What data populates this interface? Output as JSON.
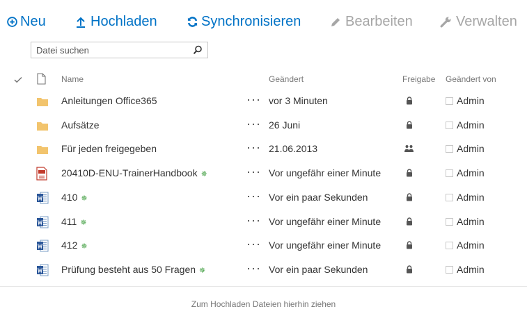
{
  "toolbar": {
    "new_label": "Neu",
    "upload_label": "Hochladen",
    "sync_label": "Synchronisieren",
    "edit_label": "Bearbeiten",
    "manage_label": "Verwalten"
  },
  "search": {
    "placeholder": "Datei suchen"
  },
  "columns": {
    "name": "Name",
    "modified": "Geändert",
    "sharing": "Freigabe",
    "modified_by": "Geändert von"
  },
  "files": [
    {
      "type": "folder",
      "name": "Anleitungen Office365",
      "is_new": false,
      "modified": "vor 3 Minuten",
      "sharing": "lock",
      "modified_by": "Admin"
    },
    {
      "type": "folder",
      "name": "Aufsätze",
      "is_new": false,
      "modified": "26 Juni",
      "sharing": "lock",
      "modified_by": "Admin"
    },
    {
      "type": "folder",
      "name": "Für jeden freigegeben",
      "is_new": false,
      "modified": "21.06.2013",
      "sharing": "people",
      "modified_by": "Admin"
    },
    {
      "type": "pdf",
      "name": "20410D-ENU-TrainerHandbook",
      "is_new": true,
      "modified": "Vor ungefähr einer Minute",
      "sharing": "lock",
      "modified_by": "Admin"
    },
    {
      "type": "word",
      "name": "410",
      "is_new": true,
      "modified": "Vor ein paar Sekunden",
      "sharing": "lock",
      "modified_by": "Admin"
    },
    {
      "type": "word",
      "name": "411",
      "is_new": true,
      "modified": "Vor ungefähr einer Minute",
      "sharing": "lock",
      "modified_by": "Admin"
    },
    {
      "type": "word",
      "name": "412",
      "is_new": true,
      "modified": "Vor ungefähr einer Minute",
      "sharing": "lock",
      "modified_by": "Admin"
    },
    {
      "type": "word",
      "name": "Prüfung besteht aus 50 Fragen",
      "is_new": true,
      "modified": "Vor ein paar Sekunden",
      "sharing": "lock",
      "modified_by": "Admin"
    }
  ],
  "dropzone": {
    "text": "Zum Hochladen Dateien hierhin ziehen"
  },
  "colors": {
    "accent": "#0072c6",
    "disabled": "#a6a6a6",
    "folder": "#f2c46d",
    "new_mark": "#3a9b3a"
  }
}
